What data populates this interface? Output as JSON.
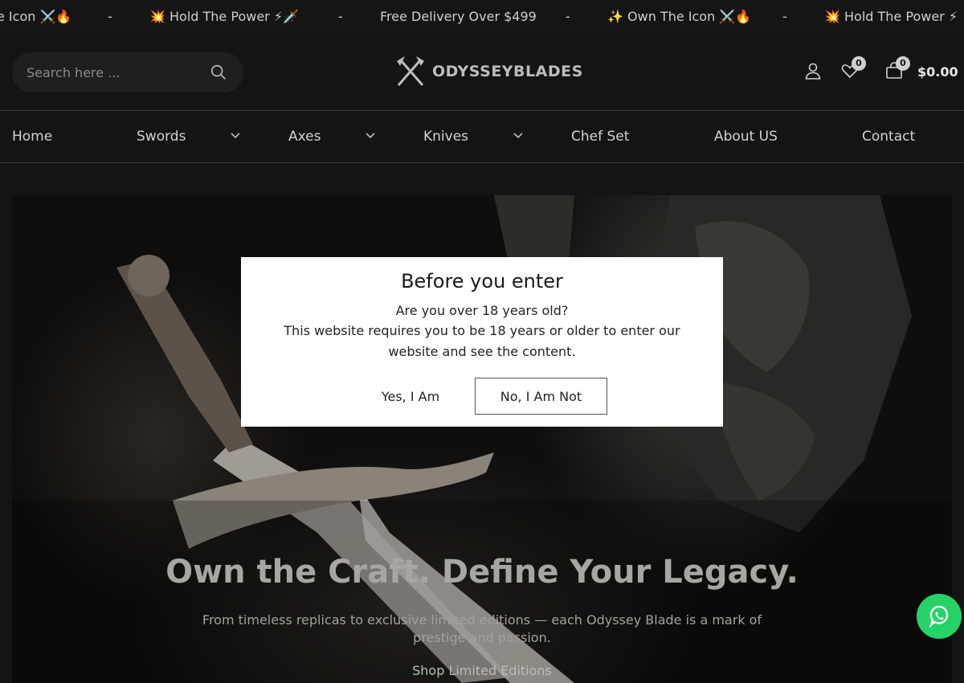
{
  "announcement": {
    "items": [
      "e Icon ⚔️🔥",
      "💥 Hold The Power ⚡🗡️",
      "Free Delivery Over $499",
      "✨ Own The Icon ⚔️🔥",
      "💥 Hold The Power ⚡"
    ],
    "separator": "-"
  },
  "header": {
    "search_placeholder": "Search here ...",
    "logo_text": "ODYSSEYBLADES",
    "wishlist_count": "0",
    "cart_count": "0",
    "cart_total": "$0.00"
  },
  "nav": {
    "items": [
      {
        "label": "Home"
      },
      {
        "label": "Swords"
      },
      {
        "label": "Axes"
      },
      {
        "label": "Knives"
      },
      {
        "label": "Chef Set"
      },
      {
        "label": "About US"
      },
      {
        "label": "Contact"
      }
    ]
  },
  "hero": {
    "title": "Own the Craft. Define Your Legacy.",
    "subtitle": "From timeless replicas to exclusive limited editions — each Odyssey Blade is a mark of prestige and passion.",
    "cta": "Shop Limited Editions"
  },
  "age_gate": {
    "title": "Before you enter",
    "question": "Are you over 18 years old?",
    "message": "This website requires you to be 18 years or older to enter our website and see the content.",
    "yes_label": "Yes, I Am",
    "no_label": "No, I Am Not"
  },
  "colors": {
    "background": "#141414",
    "whatsapp": "#25d366",
    "modal": "#ffffff"
  }
}
